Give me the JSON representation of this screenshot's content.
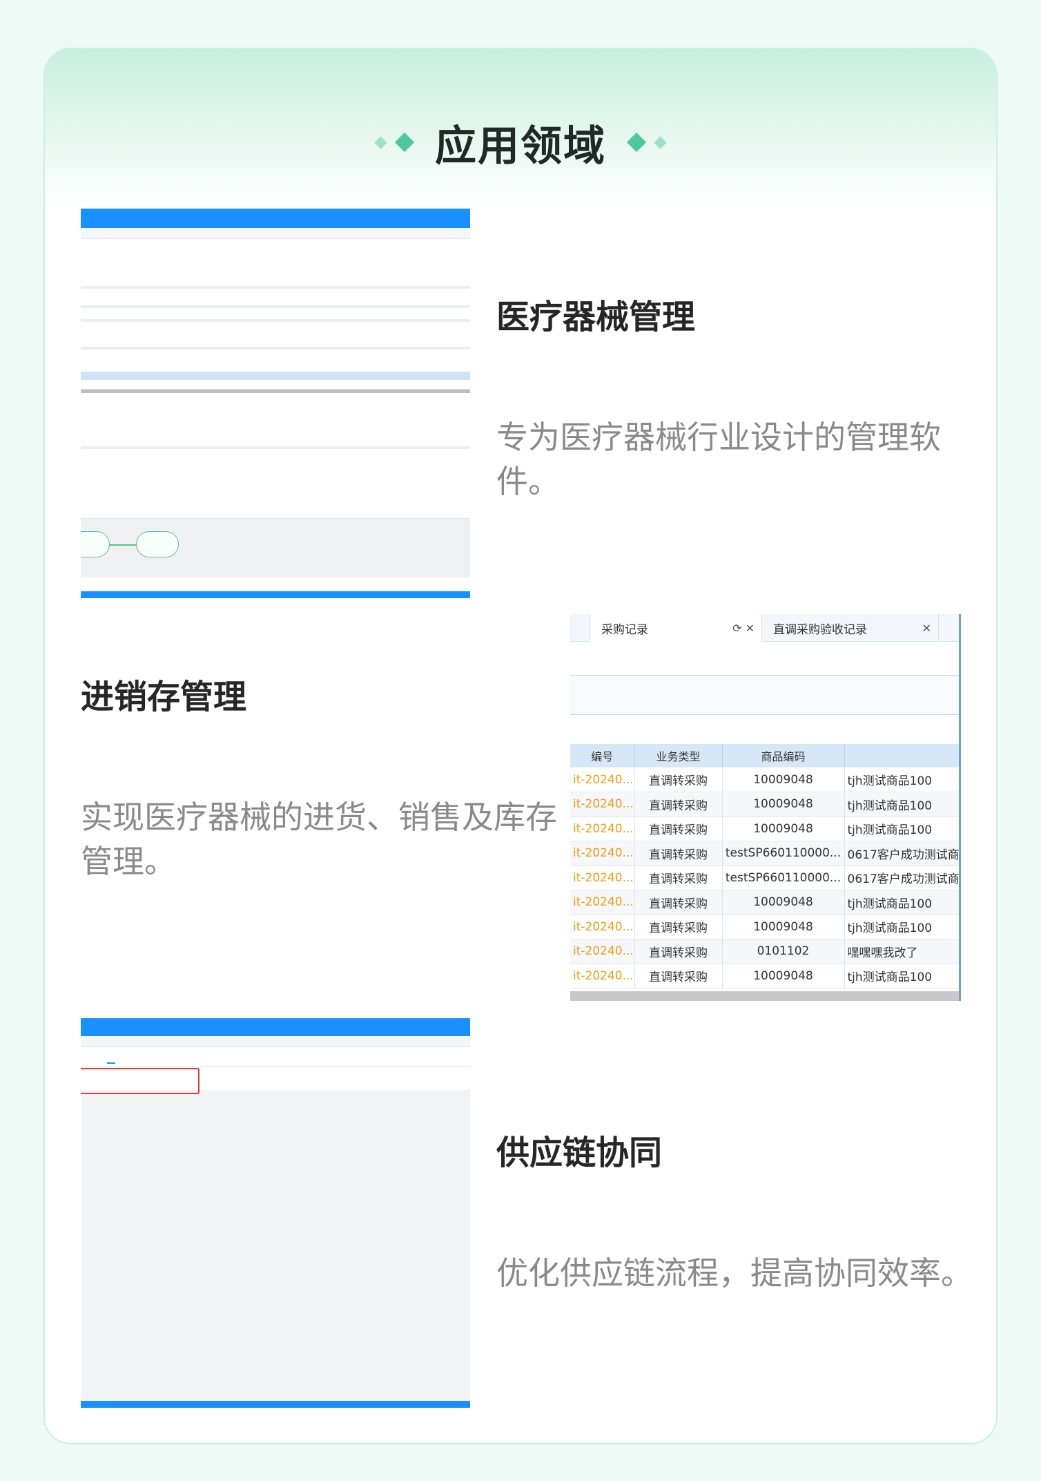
{
  "section": {
    "title": "应用领域"
  },
  "rows": [
    {
      "title": "医疗器械管理",
      "desc": "专为医疗器械行业设计的管理软件。"
    },
    {
      "title": "进销存管理",
      "desc": "实现医疗器械的进货、销售及库存管理。"
    },
    {
      "title": "供应链协同",
      "desc": "优化供应链流程，提高协同效率。"
    }
  ],
  "purchase_table": {
    "tabs": [
      {
        "label": "采购记录",
        "icons": "⟳  ✕"
      },
      {
        "label": "直调采购验收记录",
        "icons": "✕"
      }
    ],
    "columns": [
      "编号",
      "业务类型",
      "商品编码",
      ""
    ],
    "rows": [
      [
        "it-20240...",
        "直调转采购",
        "10009048",
        "tjh测试商品100"
      ],
      [
        "it-20240...",
        "直调转采购",
        "10009048",
        "tjh测试商品100"
      ],
      [
        "it-20240...",
        "直调转采购",
        "10009048",
        "tjh测试商品100"
      ],
      [
        "it-20240...",
        "直调转采购",
        "testSP660110000...",
        "0617客户成功测试商"
      ],
      [
        "it-20240...",
        "直调转采购",
        "testSP660110000...",
        "0617客户成功测试商"
      ],
      [
        "it-20240...",
        "直调转采购",
        "10009048",
        "tjh测试商品100"
      ],
      [
        "it-20240...",
        "直调转采购",
        "10009048",
        "tjh测试商品100"
      ],
      [
        "it-20240...",
        "直调转采购",
        "0101102",
        "嘿嘿嘿我改了"
      ],
      [
        "it-20240...",
        "直调转采购",
        "10009048",
        "tjh测试商品100"
      ]
    ]
  },
  "colors": {
    "accent": "#4fc79e",
    "blue": "#1890ff",
    "orange": "#f39c12"
  }
}
